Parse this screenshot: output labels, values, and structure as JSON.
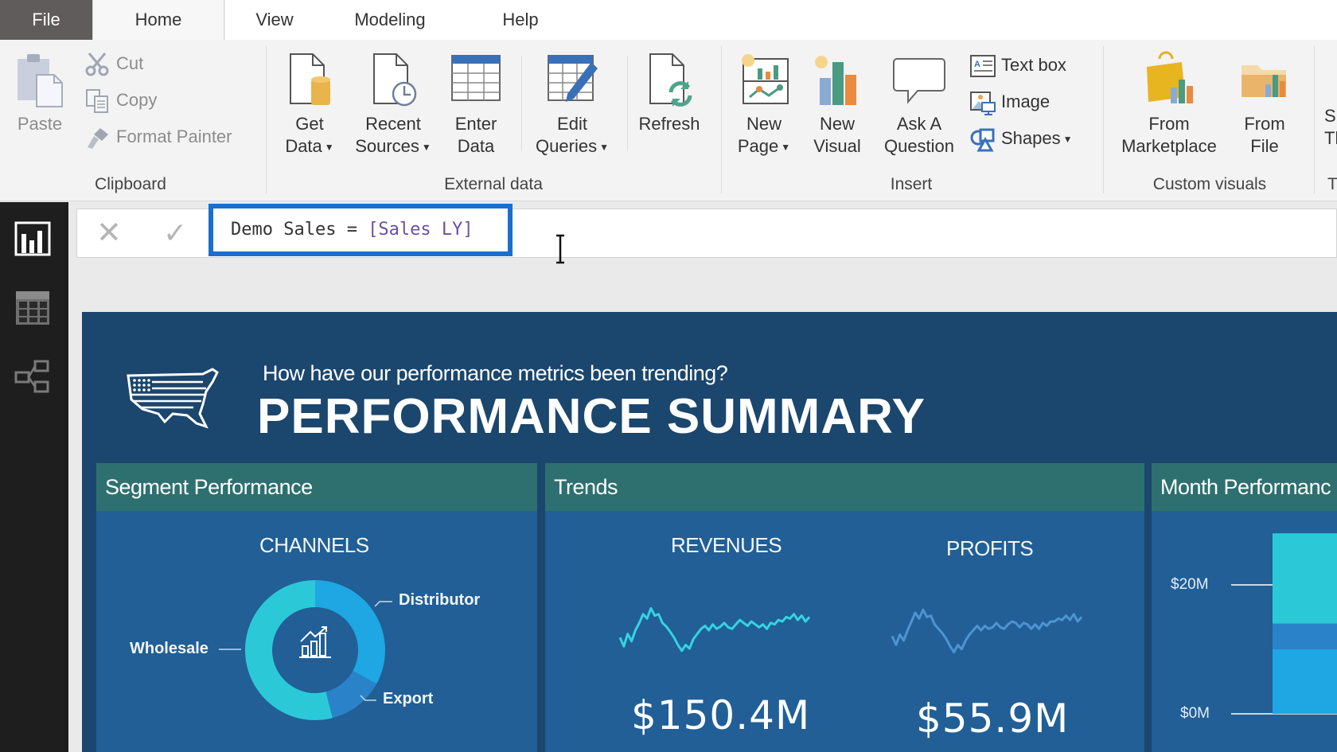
{
  "ribbon": {
    "tabs": [
      {
        "label": "File",
        "active": false
      },
      {
        "label": "Home",
        "active": true
      },
      {
        "label": "View",
        "active": false
      },
      {
        "label": "Modeling",
        "active": false
      },
      {
        "label": "Help",
        "active": false
      }
    ],
    "groups": {
      "clipboard": {
        "label": "Clipboard",
        "paste": "Paste",
        "cut": "Cut",
        "copy": "Copy",
        "format_painter": "Format Painter"
      },
      "external_data": {
        "label": "External data",
        "get_data": [
          "Get",
          "Data"
        ],
        "recent_sources": [
          "Recent",
          "Sources"
        ],
        "enter_data": [
          "Enter",
          "Data"
        ],
        "edit_queries": [
          "Edit",
          "Queries"
        ],
        "refresh": "Refresh"
      },
      "insert": {
        "label": "Insert",
        "new_page": [
          "New",
          "Page"
        ],
        "new_visual": [
          "New",
          "Visual"
        ],
        "ask_question": [
          "Ask A",
          "Question"
        ],
        "text_box": "Text box",
        "image": "Image",
        "shapes": "Shapes"
      },
      "custom_visuals": {
        "label": "Custom visuals",
        "from_marketplace": [
          "From",
          "Marketplace"
        ],
        "from_file": [
          "From",
          "File"
        ]
      },
      "themes_partial": {
        "label": "T",
        "button": [
          "S",
          "Th"
        ]
      }
    }
  },
  "rail": {
    "items": [
      {
        "name": "report-view",
        "active": true
      },
      {
        "name": "data-view",
        "active": false
      },
      {
        "name": "relationships-view",
        "active": false
      }
    ]
  },
  "formula_bar": {
    "measure_name": "Demo Sales = ",
    "reference": "[Sales LY]",
    "cancel_icon": "close-icon",
    "commit_icon": "check-icon"
  },
  "report": {
    "subtitle": "How have our performance metrics been trending?",
    "title": "PERFORMANCE SUMMARY",
    "panels": {
      "segment": {
        "header": "Segment Performance",
        "section": "CHANNELS"
      },
      "trends": {
        "header": "Trends",
        "revenues_label": "REVENUES",
        "profits_label": "PROFITS",
        "revenues_value": "$150.4M",
        "profits_value": "$55.9M"
      },
      "month": {
        "header": "Month Performanc",
        "axis_ticks": [
          "$20M",
          "$0M"
        ]
      }
    }
  },
  "colors": {
    "canvas_bg": "#1b466d",
    "panel_bg": "#215f96",
    "panel_header": "#2e7070",
    "accent_blue": "#1a6fce",
    "teal": "#2bc9d8",
    "sky": "#1ea7e2",
    "mid_blue": "#2a82c9"
  },
  "chart_data": [
    {
      "type": "pie",
      "title": "CHANNELS",
      "variant": "donut",
      "categories": [
        "Distributor",
        "Export",
        "Wholesale"
      ],
      "values": [
        33,
        13,
        54
      ],
      "unit": "percent (estimated)",
      "colors": [
        "#1ea7e2",
        "#2a82c9",
        "#2bc9d8"
      ]
    },
    {
      "type": "line",
      "title": "REVENUES",
      "kpi": "$150.4M",
      "x": [
        1,
        2,
        3,
        4,
        5,
        6,
        7,
        8,
        9,
        10,
        11,
        12,
        13,
        14,
        15,
        16,
        17,
        18,
        19,
        20,
        21,
        22,
        23,
        24,
        25,
        26,
        27,
        28,
        29,
        30,
        31,
        32,
        33,
        34,
        35,
        36,
        37,
        38,
        39,
        40,
        41,
        42,
        43,
        44,
        45,
        46,
        47,
        48,
        49,
        50
      ],
      "values": [
        40,
        28,
        45,
        35,
        50,
        60,
        72,
        66,
        80,
        70,
        72,
        60,
        55,
        48,
        40,
        30,
        22,
        30,
        25,
        38,
        45,
        52,
        56,
        50,
        58,
        52,
        55,
        60,
        54,
        52,
        58,
        64,
        60,
        56,
        62,
        58,
        54,
        58,
        52,
        60,
        58,
        64,
        62,
        68,
        66,
        72,
        64,
        70,
        62,
        68
      ],
      "ylim": [
        0,
        100
      ],
      "color": "#35d3e3"
    },
    {
      "type": "line",
      "title": "PROFITS",
      "kpi": "$55.9M",
      "x": [
        1,
        2,
        3,
        4,
        5,
        6,
        7,
        8,
        9,
        10,
        11,
        12,
        13,
        14,
        15,
        16,
        17,
        18,
        19,
        20,
        21,
        22,
        23,
        24,
        25,
        26,
        27,
        28,
        29,
        30,
        31,
        32,
        33,
        34,
        35,
        36,
        37,
        38,
        39,
        40,
        41,
        42,
        43,
        44,
        45,
        46,
        47,
        48,
        49,
        50
      ],
      "values": [
        42,
        30,
        44,
        36,
        50,
        62,
        74,
        66,
        78,
        68,
        70,
        58,
        52,
        46,
        38,
        28,
        20,
        30,
        24,
        36,
        44,
        50,
        56,
        50,
        56,
        52,
        54,
        60,
        54,
        52,
        58,
        62,
        60,
        54,
        60,
        58,
        52,
        58,
        52,
        60,
        56,
        62,
        62,
        66,
        64,
        70,
        64,
        72,
        62,
        68
      ],
      "ylim": [
        0,
        100
      ],
      "color": "#4e94d0"
    },
    {
      "type": "bar",
      "title": "Month Performance",
      "ytick_labels": [
        "$20M",
        "$0M"
      ],
      "ylim": [
        0,
        28
      ],
      "stacked_segments": [
        {
          "name": "segment-1",
          "value": 10,
          "color": "#1ea7e2"
        },
        {
          "name": "segment-2",
          "value": 4,
          "color": "#2a82c9"
        },
        {
          "name": "segment-3",
          "value": 14,
          "color": "#2bc9d8"
        }
      ],
      "note": "bar partially cropped at right edge; values estimated"
    }
  ]
}
